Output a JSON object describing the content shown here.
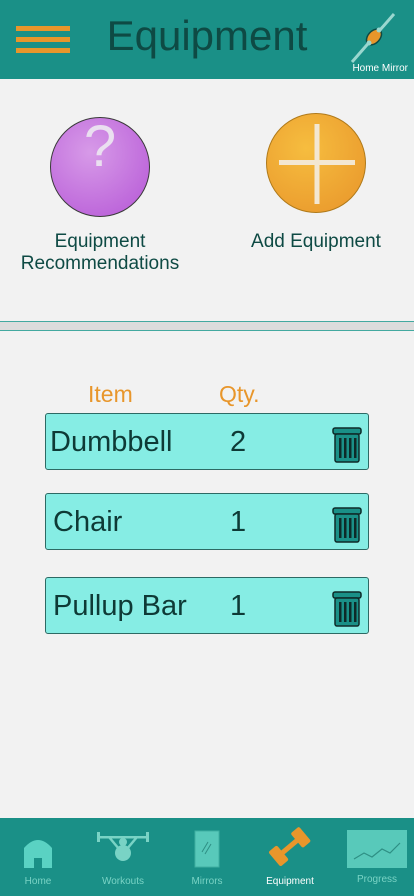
{
  "header": {
    "title": "Equipment",
    "home_mirror_label": "Home Mirror"
  },
  "actions": {
    "recommend_icon_glyph": "?",
    "recommend_line1": "Equipment",
    "recommend_line2": "Recommendations",
    "add_label": "Add Equipment"
  },
  "table": {
    "col_item": "Item",
    "col_qty": "Qty.",
    "rows": [
      {
        "name": "Dumbbell",
        "qty": "2"
      },
      {
        "name": "Chair",
        "qty": "1"
      },
      {
        "name": "Pullup Bar",
        "qty": "1"
      }
    ]
  },
  "tabs": [
    {
      "label": "Home",
      "icon": "home-icon"
    },
    {
      "label": "Workouts",
      "icon": "weightlifter-icon"
    },
    {
      "label": "Mirrors",
      "icon": "mirror-icon"
    },
    {
      "label": "Equipment",
      "icon": "dumbbell-icon",
      "active": true
    },
    {
      "label": "Progress",
      "icon": "chart-icon"
    }
  ],
  "colors": {
    "teal": "#1a9087",
    "orange": "#e8962b",
    "row": "#86ede4",
    "purple": "#c16fdc"
  }
}
